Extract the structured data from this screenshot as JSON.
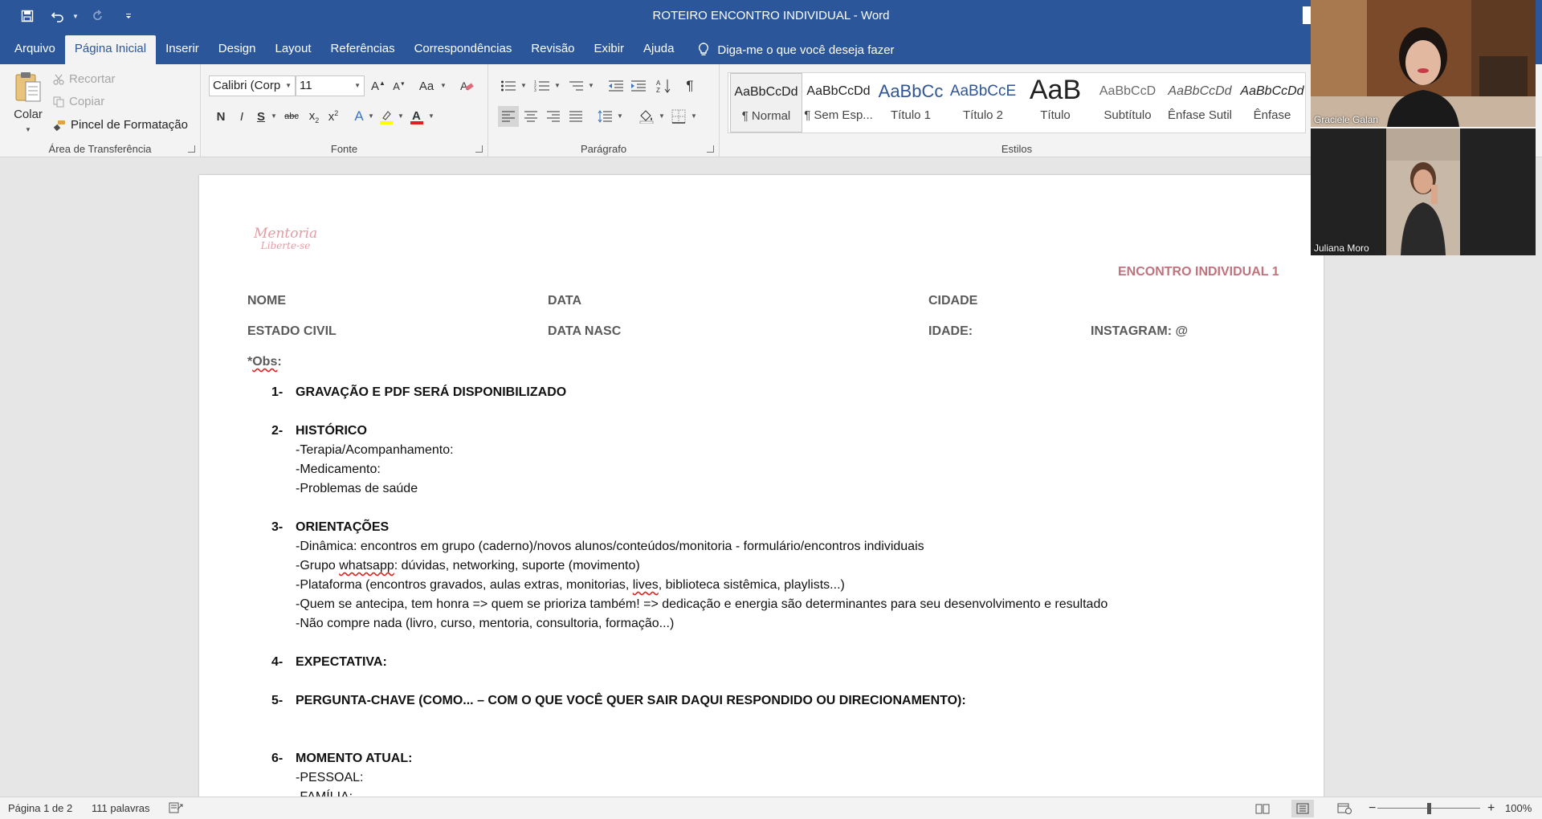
{
  "window": {
    "title": "ROTEIRO ENCONTRO INDIVIDUAL  -  Word"
  },
  "tabs": [
    "Arquivo",
    "Página Inicial",
    "Inserir",
    "Design",
    "Layout",
    "Referências",
    "Correspondências",
    "Revisão",
    "Exibir",
    "Ajuda"
  ],
  "active_tab_index": 1,
  "tell_me": "Diga-me o que você deseja fazer",
  "ribbon": {
    "clipboard": {
      "label": "Área de Transferência",
      "paste": "Colar",
      "cut": "Recortar",
      "copy": "Copiar",
      "format_painter": "Pincel de Formatação"
    },
    "font": {
      "label": "Fonte",
      "family": "Calibri (Corp",
      "size": "11"
    },
    "paragraph": {
      "label": "Parágrafo"
    },
    "styles": {
      "label": "Estilos",
      "items": [
        {
          "preview": "AaBbCcDd",
          "name": "¶ Normal"
        },
        {
          "preview": "AaBbCcDd",
          "name": "¶ Sem Esp..."
        },
        {
          "preview": "AaBbCc",
          "name": "Título 1"
        },
        {
          "preview": "AaBbCcE",
          "name": "Título 2"
        },
        {
          "preview": "AaB",
          "name": "Título"
        },
        {
          "preview": "AaBbCcD",
          "name": "Subtítulo"
        },
        {
          "preview": "AaBbCcDd",
          "name": "Ênfase Sutil"
        },
        {
          "preview": "AaBbCcDd",
          "name": "Ênfase"
        }
      ]
    }
  },
  "doc": {
    "logo_line1": "Mentoria",
    "logo_line2": "Liberte-se",
    "header_title": "ENCONTRO INDIVIDUAL 1",
    "fields": {
      "nome": "NOME",
      "data": "DATA",
      "cidade": "CIDADE",
      "estado_civil": "ESTADO CIVIL",
      "data_nasc": "DATA NASC",
      "idade": "IDADE:",
      "instagram": "INSTAGRAM: @"
    },
    "obs_prefix": "*",
    "obs_word": "Obs",
    "obs_suffix": ":",
    "items": [
      {
        "num": "1-",
        "heading": "GRAVAÇÃO E PDF SERÁ DISPONIBILIZADO"
      },
      {
        "num": "2-",
        "heading": "HISTÓRICO",
        "lines": [
          "-Terapia/Acompanhamento:",
          "-Medicamento:",
          "-Problemas de saúde"
        ]
      },
      {
        "num": "3-",
        "heading": "ORIENTAÇÕES",
        "lines": [
          "-Dinâmica: encontros em grupo (caderno)/novos alunos/conteúdos/monitoria - formulário/encontros individuais",
          "-Grupo whatsapp: dúvidas, networking, suporte (movimento)",
          "-Plataforma (encontros gravados, aulas extras, monitorias, lives, biblioteca sistêmica, playlists...)",
          "-Quem se antecipa, tem honra => quem se prioriza também! => dedicação e energia são determinantes para seu desenvolvimento e resultado",
          "-Não compre nada (livro, curso, mentoria, consultoria, formação...)"
        ]
      },
      {
        "num": "4-",
        "heading": "EXPECTATIVA:"
      },
      {
        "num": "5-",
        "heading": "PERGUNTA-CHAVE (COMO... – COM O QUE VOCÊ QUER SAIR DAQUI RESPONDIDO OU DIRECIONAMENTO):"
      },
      {
        "num": "6-",
        "heading": "MOMENTO ATUAL:",
        "lines": [
          "-PESSOAL:",
          "-FAMÍLIA:"
        ]
      }
    ],
    "line2_prefix": "-Grupo ",
    "line2_squig": "whatsapp",
    "line2_suffix": ": dúvidas, networking, suporte (movimento)",
    "line3_prefix": "-Plataforma (encontros gravados, aulas extras, monitorias, ",
    "line3_squig": "lives",
    "line3_suffix": ", biblioteca sistêmica, playlists...)"
  },
  "participants": [
    {
      "name": "Graciele Galan"
    },
    {
      "name": "Juliana Moro"
    }
  ],
  "status": {
    "page": "Página 1 de 2",
    "words": "111 palavras",
    "zoom": "100%",
    "zoom_fraction": 0.5
  },
  "colors": {
    "brand": "#2b579a",
    "accent_heading": "#c0727d",
    "logo": "#e69aa4"
  }
}
